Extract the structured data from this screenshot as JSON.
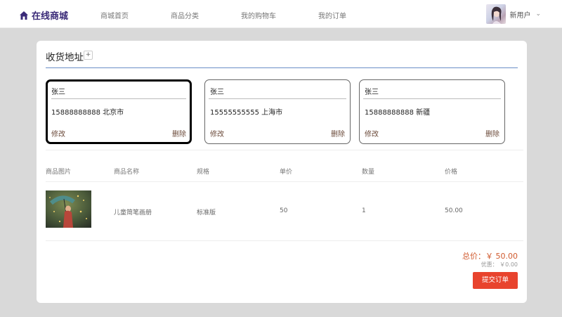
{
  "header": {
    "brand": "在线商城",
    "brand_icon": "home-icon",
    "nav": [
      "商城首页",
      "商品分类",
      "我的购物车",
      "我的订单"
    ],
    "user": {
      "name": "新用户",
      "caret_icon": "chevron-down-icon"
    }
  },
  "address_section": {
    "title": "收货地址",
    "add_label": "+",
    "addresses": [
      {
        "name": "张三",
        "info": "15888888888 北京市",
        "edit": "修改",
        "delete": "删除",
        "selected": true
      },
      {
        "name": "张三",
        "info": "15555555555 上海市",
        "edit": "修改",
        "delete": "删除",
        "selected": false
      },
      {
        "name": "张三",
        "info": "15888888888 新疆",
        "edit": "修改",
        "delete": "删除",
        "selected": false
      }
    ]
  },
  "table": {
    "headers": [
      "商品图片",
      "商品名称",
      "规格",
      "单价",
      "数量",
      "价格"
    ],
    "rows": [
      {
        "name": "儿童简笔画册",
        "spec": "标准版",
        "unit_price": "50",
        "quantity": "1",
        "price": "50.00"
      }
    ]
  },
  "summary": {
    "total": "总价：￥ 50.00",
    "discount": "优惠：  ￥0.00",
    "submit": "提交订单"
  },
  "colors": {
    "brand": "#3a2a78",
    "accent": "#e8432d",
    "price": "#d05a2e",
    "link": "#6b4a3a"
  }
}
